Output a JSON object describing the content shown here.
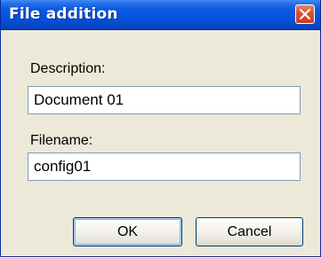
{
  "dialog": {
    "title": "File addition",
    "close_icon": "close-icon",
    "description_label": "Description:",
    "description_value": "Document 01",
    "filename_label": "Filename:",
    "filename_value": "config01",
    "ok_label": "OK",
    "cancel_label": "Cancel"
  },
  "colors": {
    "titlebar": "#0653dd",
    "close_button": "#d9502a",
    "dialog_background": "#ece9d8",
    "field_border": "#7f9db9"
  }
}
